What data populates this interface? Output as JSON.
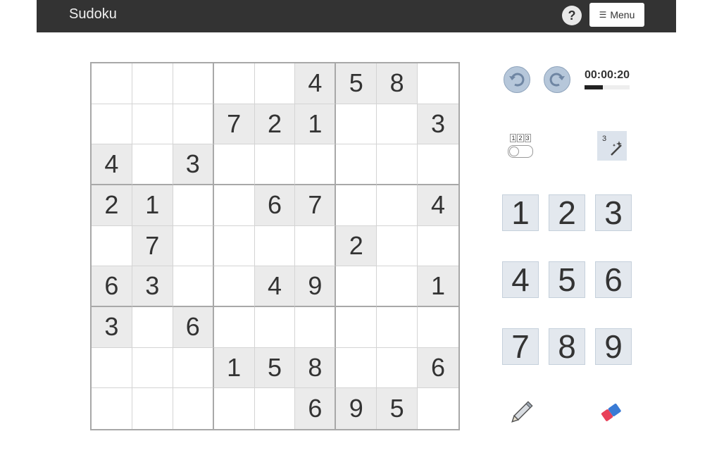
{
  "navbar": {
    "brand": "Sudoku",
    "help_label": "?",
    "menu_label": "Menu",
    "menu_icon": "hamburger-icon"
  },
  "board": {
    "rows": [
      [
        "",
        "",
        "",
        "",
        "",
        "4",
        "5",
        "8",
        ""
      ],
      [
        "",
        "",
        "",
        "7",
        "2",
        "1",
        "",
        "",
        "3"
      ],
      [
        "4",
        "",
        "3",
        "",
        "",
        "",
        "",
        "",
        ""
      ],
      [
        "2",
        "1",
        "",
        "",
        "6",
        "7",
        "",
        "",
        "4"
      ],
      [
        "",
        "7",
        "",
        "",
        "",
        "",
        "2",
        "",
        ""
      ],
      [
        "6",
        "3",
        "",
        "",
        "4",
        "9",
        "",
        "",
        "1"
      ],
      [
        "3",
        "",
        "6",
        "",
        "",
        "",
        "",
        "",
        ""
      ],
      [
        "",
        "",
        "",
        "1",
        "5",
        "8",
        "",
        "",
        "6"
      ],
      [
        "",
        "",
        "",
        "",
        "",
        "6",
        "9",
        "5",
        ""
      ]
    ]
  },
  "controls": {
    "undo_icon": "undo-icon",
    "redo_icon": "redo-icon",
    "timer": "00:00:20",
    "timer_progress": 0.4,
    "notes_toggle_nums": [
      "1",
      "2",
      "3"
    ],
    "notes_toggle_on": false,
    "hint_number": "3",
    "hint_icon": "magic-wand-icon"
  },
  "numpad": [
    "1",
    "2",
    "3",
    "4",
    "5",
    "6",
    "7",
    "8",
    "9"
  ],
  "tools": {
    "pencil_icon": "pencil-icon",
    "eraser_icon": "eraser-icon"
  },
  "colors": {
    "navbar": "#333333",
    "given_cell": "#ebebeb",
    "button": "#e3e8ee"
  }
}
